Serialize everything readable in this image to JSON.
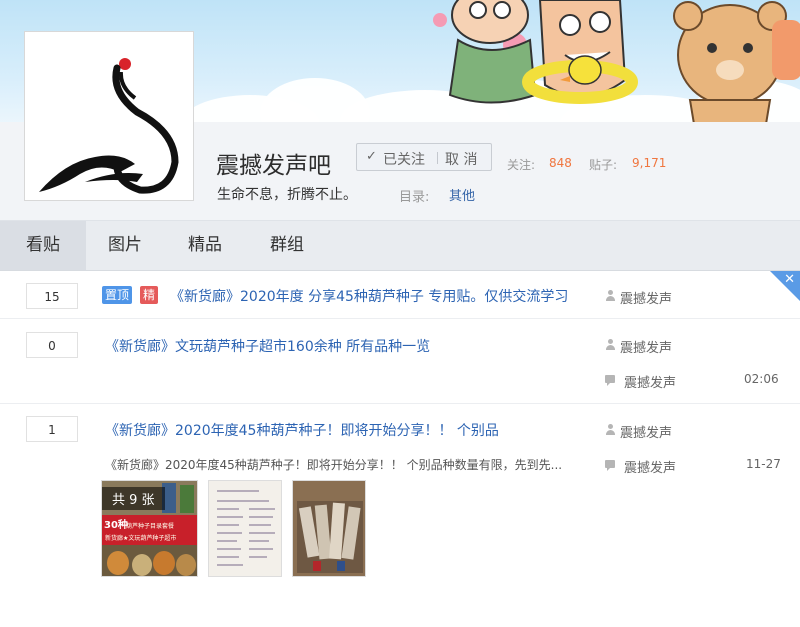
{
  "forum": {
    "name": "震撼发声吧",
    "slogan": "生命不息，折腾不止。",
    "follow_label": "已关注",
    "cancel_label": "取 消",
    "followers_label": "关注:",
    "followers_count": "848",
    "posts_label": "贴子:",
    "posts_count": "9,171",
    "directory_label": "目录:",
    "directory_value": "其他"
  },
  "tabs": [
    {
      "label": "看贴",
      "active": true
    },
    {
      "label": "图片",
      "active": false
    },
    {
      "label": "精品",
      "active": false
    },
    {
      "label": "群组",
      "active": false
    }
  ],
  "threads": [
    {
      "replies": "15",
      "badges": [
        "置顶",
        "精"
      ],
      "title": "《新货廊》2020年度 分享45种葫芦种子 专用贴。仅供交流学习",
      "author": "震撼发声"
    },
    {
      "replies": "0",
      "title": "《新货廊》文玩葫芦种子超市160余种 所有品种一览",
      "author": "震撼发声",
      "last_replier": "震撼发声",
      "time": "02:06"
    },
    {
      "replies": "1",
      "title": "《新货廊》2020年度45种葫芦种子！即将开始分享！！ 个别品",
      "author": "震撼发声",
      "abstract": "《新货廊》2020年度45种葫芦种子！即将开始分享！！ 个别品种数量有限，先到先...",
      "last_replier": "震撼发声",
      "time": "11-27",
      "image_count": "共 9 张",
      "thumb1_text_line1": "30种",
      "thumb1_text_line2": "葫芦种子目录套餐",
      "thumb1_text_line3": "新货廊★文玩葫芦种子超市"
    }
  ],
  "colors": {
    "link": "#2d64b3",
    "accent": "#f0763f",
    "badge_top": "#4f95e8",
    "badge_good": "#e55a5a"
  }
}
